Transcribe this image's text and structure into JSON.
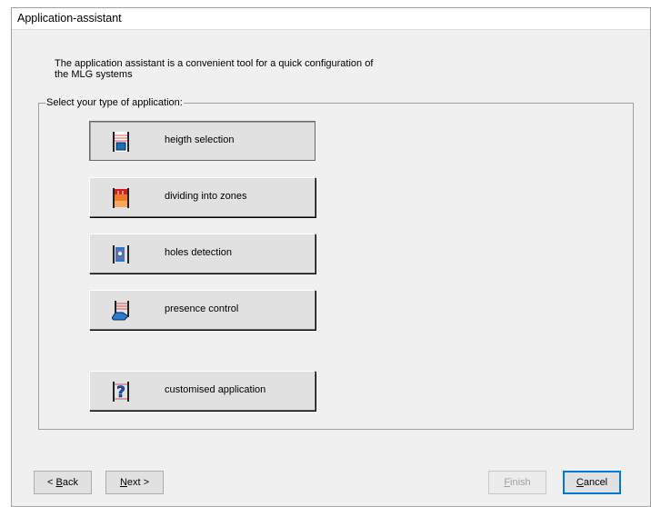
{
  "window": {
    "title": "Application-assistant"
  },
  "intro": {
    "line1": "The application assistant is a convenient tool for a quick configuration of",
    "line2": "the MLG systems"
  },
  "group": {
    "label": "Select your type of application:"
  },
  "applications": [
    {
      "label": "heigth selection",
      "icon": "height-selection-icon"
    },
    {
      "label": "dividing into zones",
      "icon": "zones-icon"
    },
    {
      "label": "holes detection",
      "icon": "holes-detection-icon"
    },
    {
      "label": "presence control",
      "icon": "presence-control-icon"
    },
    {
      "label": "customised application",
      "icon": "customised-application-icon"
    }
  ],
  "buttons": {
    "back_prefix": "< ",
    "back_accel": "B",
    "back_rest": "ack",
    "next_accel": "N",
    "next_rest": "ext >",
    "finish_accel": "F",
    "finish_rest": "inish",
    "cancel_accel": "C",
    "cancel_rest": "ancel"
  },
  "colors": {
    "window_bg": "#f0f0f0",
    "button_bg": "#e1e1e1",
    "accent": "#0078d7"
  }
}
